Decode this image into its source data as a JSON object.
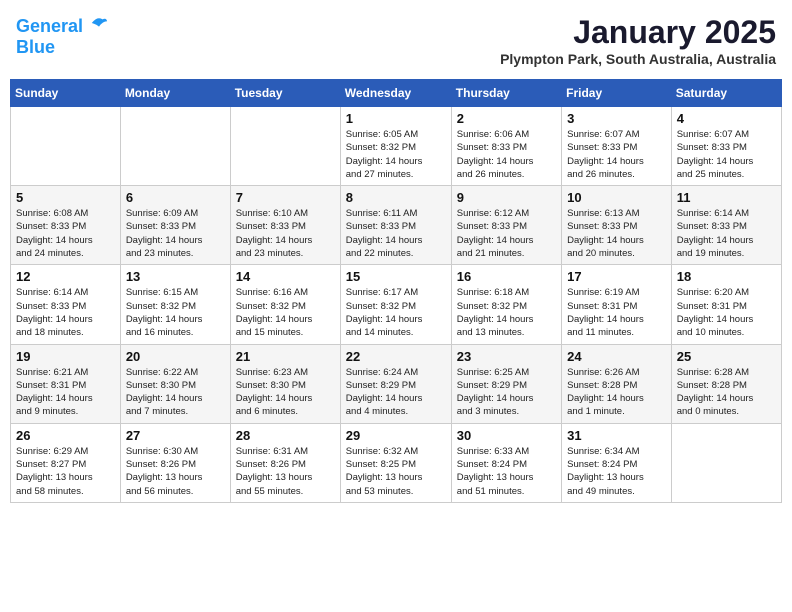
{
  "logo": {
    "line1": "General",
    "line2": "Blue"
  },
  "title": "January 2025",
  "location": "Plympton Park, South Australia, Australia",
  "weekdays": [
    "Sunday",
    "Monday",
    "Tuesday",
    "Wednesday",
    "Thursday",
    "Friday",
    "Saturday"
  ],
  "weeks": [
    [
      {
        "day": "",
        "info": ""
      },
      {
        "day": "",
        "info": ""
      },
      {
        "day": "",
        "info": ""
      },
      {
        "day": "1",
        "info": "Sunrise: 6:05 AM\nSunset: 8:32 PM\nDaylight: 14 hours\nand 27 minutes."
      },
      {
        "day": "2",
        "info": "Sunrise: 6:06 AM\nSunset: 8:33 PM\nDaylight: 14 hours\nand 26 minutes."
      },
      {
        "day": "3",
        "info": "Sunrise: 6:07 AM\nSunset: 8:33 PM\nDaylight: 14 hours\nand 26 minutes."
      },
      {
        "day": "4",
        "info": "Sunrise: 6:07 AM\nSunset: 8:33 PM\nDaylight: 14 hours\nand 25 minutes."
      }
    ],
    [
      {
        "day": "5",
        "info": "Sunrise: 6:08 AM\nSunset: 8:33 PM\nDaylight: 14 hours\nand 24 minutes."
      },
      {
        "day": "6",
        "info": "Sunrise: 6:09 AM\nSunset: 8:33 PM\nDaylight: 14 hours\nand 23 minutes."
      },
      {
        "day": "7",
        "info": "Sunrise: 6:10 AM\nSunset: 8:33 PM\nDaylight: 14 hours\nand 23 minutes."
      },
      {
        "day": "8",
        "info": "Sunrise: 6:11 AM\nSunset: 8:33 PM\nDaylight: 14 hours\nand 22 minutes."
      },
      {
        "day": "9",
        "info": "Sunrise: 6:12 AM\nSunset: 8:33 PM\nDaylight: 14 hours\nand 21 minutes."
      },
      {
        "day": "10",
        "info": "Sunrise: 6:13 AM\nSunset: 8:33 PM\nDaylight: 14 hours\nand 20 minutes."
      },
      {
        "day": "11",
        "info": "Sunrise: 6:14 AM\nSunset: 8:33 PM\nDaylight: 14 hours\nand 19 minutes."
      }
    ],
    [
      {
        "day": "12",
        "info": "Sunrise: 6:14 AM\nSunset: 8:33 PM\nDaylight: 14 hours\nand 18 minutes."
      },
      {
        "day": "13",
        "info": "Sunrise: 6:15 AM\nSunset: 8:32 PM\nDaylight: 14 hours\nand 16 minutes."
      },
      {
        "day": "14",
        "info": "Sunrise: 6:16 AM\nSunset: 8:32 PM\nDaylight: 14 hours\nand 15 minutes."
      },
      {
        "day": "15",
        "info": "Sunrise: 6:17 AM\nSunset: 8:32 PM\nDaylight: 14 hours\nand 14 minutes."
      },
      {
        "day": "16",
        "info": "Sunrise: 6:18 AM\nSunset: 8:32 PM\nDaylight: 14 hours\nand 13 minutes."
      },
      {
        "day": "17",
        "info": "Sunrise: 6:19 AM\nSunset: 8:31 PM\nDaylight: 14 hours\nand 11 minutes."
      },
      {
        "day": "18",
        "info": "Sunrise: 6:20 AM\nSunset: 8:31 PM\nDaylight: 14 hours\nand 10 minutes."
      }
    ],
    [
      {
        "day": "19",
        "info": "Sunrise: 6:21 AM\nSunset: 8:31 PM\nDaylight: 14 hours\nand 9 minutes."
      },
      {
        "day": "20",
        "info": "Sunrise: 6:22 AM\nSunset: 8:30 PM\nDaylight: 14 hours\nand 7 minutes."
      },
      {
        "day": "21",
        "info": "Sunrise: 6:23 AM\nSunset: 8:30 PM\nDaylight: 14 hours\nand 6 minutes."
      },
      {
        "day": "22",
        "info": "Sunrise: 6:24 AM\nSunset: 8:29 PM\nDaylight: 14 hours\nand 4 minutes."
      },
      {
        "day": "23",
        "info": "Sunrise: 6:25 AM\nSunset: 8:29 PM\nDaylight: 14 hours\nand 3 minutes."
      },
      {
        "day": "24",
        "info": "Sunrise: 6:26 AM\nSunset: 8:28 PM\nDaylight: 14 hours\nand 1 minute."
      },
      {
        "day": "25",
        "info": "Sunrise: 6:28 AM\nSunset: 8:28 PM\nDaylight: 14 hours\nand 0 minutes."
      }
    ],
    [
      {
        "day": "26",
        "info": "Sunrise: 6:29 AM\nSunset: 8:27 PM\nDaylight: 13 hours\nand 58 minutes."
      },
      {
        "day": "27",
        "info": "Sunrise: 6:30 AM\nSunset: 8:26 PM\nDaylight: 13 hours\nand 56 minutes."
      },
      {
        "day": "28",
        "info": "Sunrise: 6:31 AM\nSunset: 8:26 PM\nDaylight: 13 hours\nand 55 minutes."
      },
      {
        "day": "29",
        "info": "Sunrise: 6:32 AM\nSunset: 8:25 PM\nDaylight: 13 hours\nand 53 minutes."
      },
      {
        "day": "30",
        "info": "Sunrise: 6:33 AM\nSunset: 8:24 PM\nDaylight: 13 hours\nand 51 minutes."
      },
      {
        "day": "31",
        "info": "Sunrise: 6:34 AM\nSunset: 8:24 PM\nDaylight: 13 hours\nand 49 minutes."
      },
      {
        "day": "",
        "info": ""
      }
    ]
  ]
}
